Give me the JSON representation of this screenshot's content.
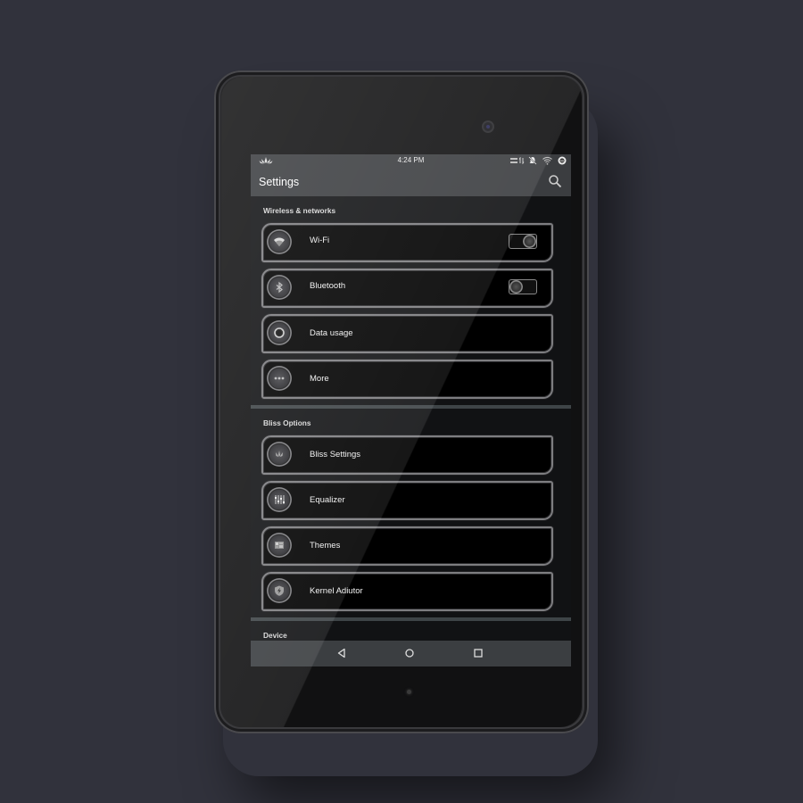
{
  "status_bar": {
    "time": "4:24 PM",
    "icons": [
      "bliss-lotus-icon",
      "data-activity-icon",
      "notifications-muted-icon",
      "wifi-signal-icon",
      "battery-icon"
    ]
  },
  "app_bar": {
    "title": "Settings",
    "search_icon": "search-icon"
  },
  "sections": [
    {
      "header": "Wireless & networks",
      "items": [
        {
          "label": "Wi-Fi",
          "icon": "wifi-icon",
          "toggle": true,
          "toggle_on": true
        },
        {
          "label": "Bluetooth",
          "icon": "bluetooth-icon",
          "toggle": true,
          "toggle_on": false
        },
        {
          "label": "Data usage",
          "icon": "data-usage-icon",
          "toggle": false
        },
        {
          "label": "More",
          "icon": "more-icon",
          "toggle": false
        }
      ]
    },
    {
      "header": "Bliss Options",
      "items": [
        {
          "label": "Bliss Settings",
          "icon": "bliss-icon",
          "toggle": false
        },
        {
          "label": "Equalizer",
          "icon": "equalizer-icon",
          "toggle": false
        },
        {
          "label": "Themes",
          "icon": "themes-icon",
          "toggle": false
        },
        {
          "label": "Kernel Adiutor",
          "icon": "kernel-icon",
          "toggle": false
        }
      ]
    },
    {
      "header": "Device",
      "items": []
    }
  ],
  "nav_bar": {
    "back": "back-icon",
    "home": "home-icon",
    "recents": "recents-icon"
  },
  "colors": {
    "background": "#31323c",
    "bars": "#3b3d40",
    "screen": "#111214",
    "card": "#000000",
    "card_border": "#7d7d80"
  }
}
